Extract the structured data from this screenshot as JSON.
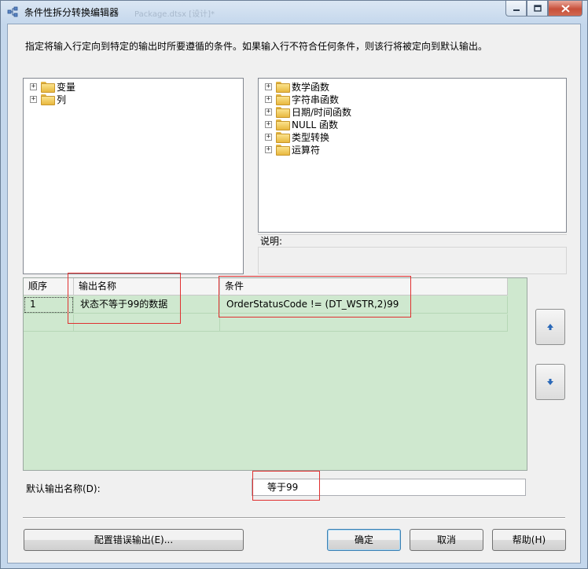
{
  "window": {
    "title": "条件性拆分转换编辑器",
    "background_title": "Package.dtsx [设计]*",
    "minimize_icon": "minimize-icon",
    "maximize_icon": "maximize-icon",
    "close_icon": "close-icon"
  },
  "description": "指定将输入行定向到特定的输出时所要遵循的条件。如果输入行不符合任何条件，则该行将被定向到默认输出。",
  "left_tree": {
    "items": [
      {
        "label": "变量",
        "icon": "folder-icon"
      },
      {
        "label": "列",
        "icon": "folder-icon"
      }
    ]
  },
  "right_tree": {
    "items": [
      {
        "label": "数学函数",
        "icon": "folder-icon"
      },
      {
        "label": "字符串函数",
        "icon": "folder-icon"
      },
      {
        "label": "日期/时间函数",
        "icon": "folder-icon"
      },
      {
        "label": "NULL 函数",
        "icon": "folder-icon"
      },
      {
        "label": "类型转换",
        "icon": "folder-icon"
      },
      {
        "label": "运算符",
        "icon": "folder-icon"
      }
    ]
  },
  "description_panel": {
    "label": "说明:"
  },
  "grid": {
    "columns": [
      "顺序",
      "输出名称",
      "条件"
    ],
    "rows": [
      {
        "order": "1",
        "output_name": "状态不等于99的数据",
        "condition": "OrderStatusCode != (DT_WSTR,2)99"
      }
    ]
  },
  "move_up_icon": "arrow-up-icon",
  "move_down_icon": "arrow-down-icon",
  "default_output": {
    "label": "默认输出名称(D):",
    "value": "等于99"
  },
  "buttons": {
    "configure_error": "配置错误输出(E)...",
    "ok": "确定",
    "cancel": "取消",
    "help": "帮助(H)"
  },
  "colors": {
    "grid_background": "#cfe8cf",
    "highlight_box": "#e03030",
    "arrow": "#2a68b8"
  }
}
